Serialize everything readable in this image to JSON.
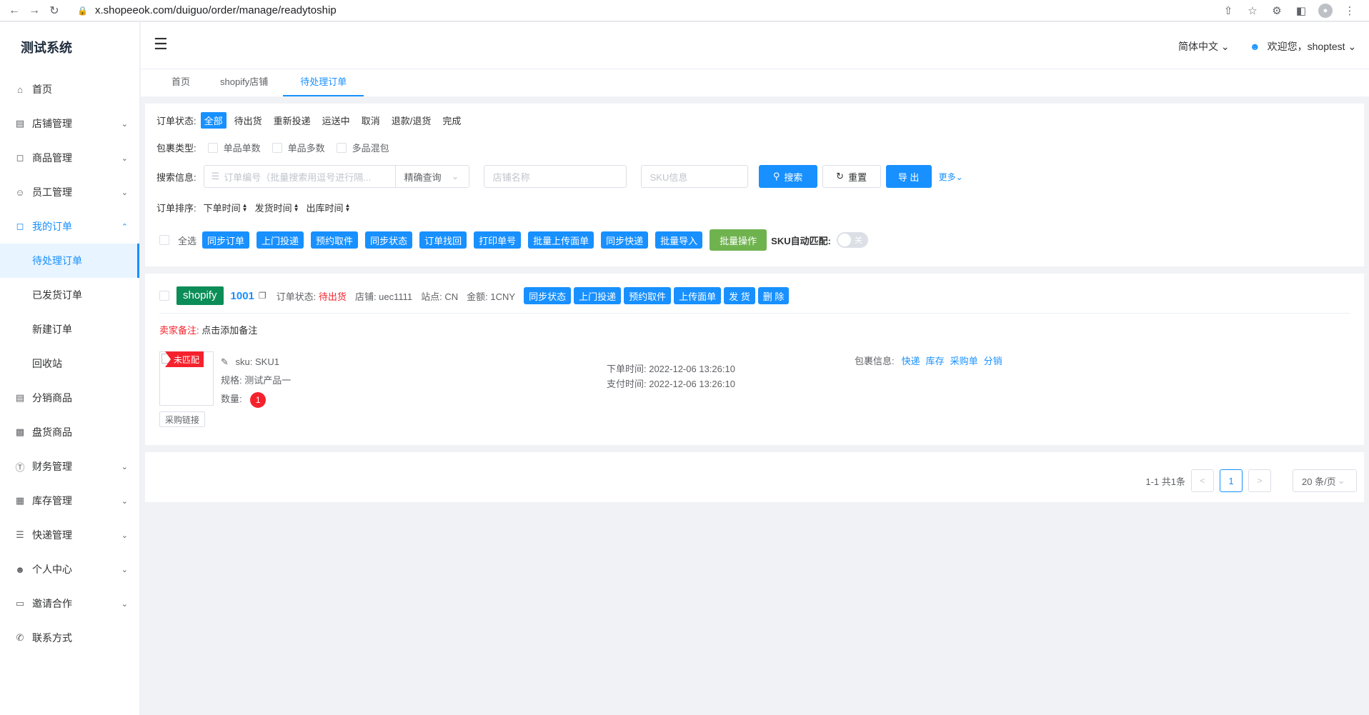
{
  "browser": {
    "url": "x.shopeeok.com/duiguo/order/manage/readytoship"
  },
  "sidebar": {
    "logo": "测试系统",
    "items": [
      {
        "label": "首页"
      },
      {
        "label": "店铺管理"
      },
      {
        "label": "商品管理"
      },
      {
        "label": "员工管理"
      },
      {
        "label": "我的订单"
      },
      {
        "label": "分销商品"
      },
      {
        "label": "盘货商品"
      },
      {
        "label": "财务管理"
      },
      {
        "label": "库存管理"
      },
      {
        "label": "快递管理"
      },
      {
        "label": "个人中心"
      },
      {
        "label": "邀请合作"
      },
      {
        "label": "联系方式"
      }
    ],
    "order_sub": [
      {
        "label": "待处理订单"
      },
      {
        "label": "已发货订单"
      },
      {
        "label": "新建订单"
      },
      {
        "label": "回收站"
      }
    ]
  },
  "header": {
    "lang": "简体中文",
    "welcome": "欢迎您，shoptest"
  },
  "tabs": [
    {
      "label": "首页"
    },
    {
      "label": "shopify店铺"
    },
    {
      "label": "待处理订单"
    }
  ],
  "filter": {
    "status_label": "订单状态:",
    "statuses": [
      "全部",
      "待出货",
      "重新投递",
      "运送中",
      "取消",
      "退款/退货",
      "完成"
    ],
    "package_label": "包裹类型:",
    "packages": [
      "单品单数",
      "单品多数",
      "多品混包"
    ],
    "search_label": "搜索信息:",
    "order_placeholder": "订单编号（批量搜索用逗号进行隔...",
    "query_mode": "精确查询",
    "shop_placeholder": "店铺名称",
    "sku_placeholder": "SKU信息",
    "search_btn": "搜索",
    "reset_btn": "重置",
    "export_btn": "导 出",
    "more": "更多",
    "sort_label": "订单排序:",
    "sorts": [
      "下单时间",
      "发货时间",
      "出库时间"
    ],
    "select_all": "全选",
    "batch_buttons": [
      "同步订单",
      "上门投递",
      "预约取件",
      "同步状态",
      "订单找回",
      "打印单号",
      "批量上传面单",
      "同步快递",
      "批量导入"
    ],
    "batch_op": "批量操作",
    "sku_auto_label": "SKU自动匹配:",
    "toggle_text": "关"
  },
  "order": {
    "shop": "shopify",
    "number": "1001",
    "status_label": "订单状态:",
    "status": "待出货",
    "store": "店铺: uec1111",
    "site": "站点: CN",
    "amount": "金额: 1CNY",
    "buttons": [
      "同步状态",
      "上门投递",
      "预约取件",
      "上传面单",
      "发 货",
      "删 除"
    ],
    "remark_label": "卖家备注:",
    "remark_action": "点击添加备注",
    "unmatched": "未匹配",
    "purchase_link": "采购链接",
    "sku": "sku: SKU1",
    "spec": "规格:   测试产品一",
    "qty_label": "数量:",
    "qty": "1",
    "order_time": "下单时间:   2022-12-06 13:26:10",
    "pay_time": "支付时间:   2022-12-06 13:26:10",
    "package_label": "包裹信息:",
    "package_links": [
      "快递",
      "库存",
      "采购单",
      "分销"
    ]
  },
  "pagination": {
    "summary": "1-1 共1条",
    "current": "1",
    "page_size": "20 条/页"
  }
}
